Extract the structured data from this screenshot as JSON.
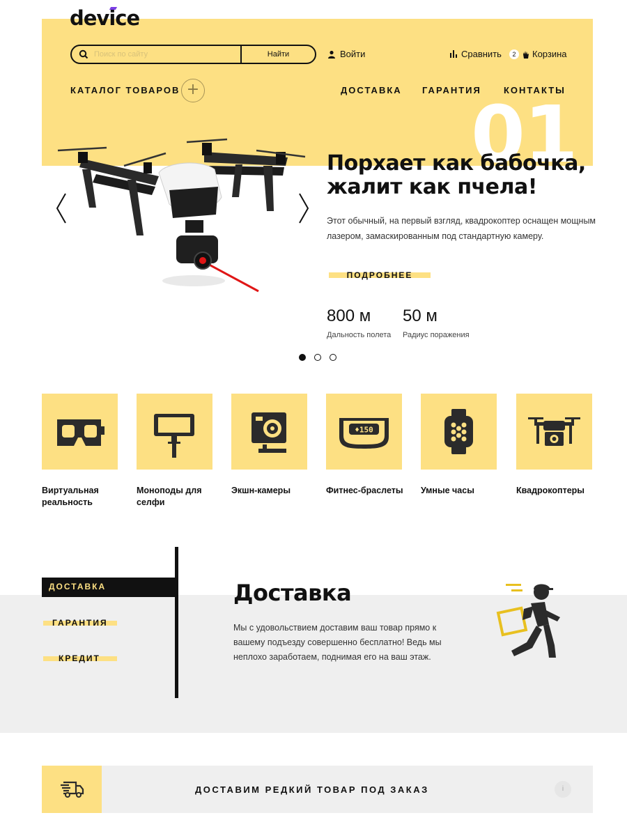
{
  "header": {
    "logo": "device",
    "search": {
      "placeholder": "Поиск по сайту",
      "button": "Найти"
    },
    "login": "Войти",
    "compare": "Сравнить",
    "cart": {
      "label": "Корзина",
      "count": "2"
    },
    "catalog": "КАТАЛОГ ТОВАРОВ",
    "nav": [
      "ДОСТАВКА",
      "ГАРАНТИЯ",
      "КОНТАКТЫ"
    ]
  },
  "slider": {
    "number": "01",
    "title": "Порхает как бабочка, жалит как пчела!",
    "text": "Этот обычный, на первый взгляд, квадрокоптер оснащен мощным лазером, замаскированным под стандартную камеру.",
    "more": "ПОДРОБНЕЕ",
    "stats": [
      {
        "value": "800 м",
        "label": "Дальность полета"
      },
      {
        "value": "50 м",
        "label": "Радиус поражения"
      }
    ],
    "active_dot": 1,
    "dots": 3
  },
  "categories": [
    {
      "label": "Виртуальная реальность",
      "icon": "vr-headset-icon"
    },
    {
      "label": "Моноподы для селфи",
      "icon": "selfie-stick-icon"
    },
    {
      "label": "Экшн-камеры",
      "icon": "action-camera-icon"
    },
    {
      "label": "Фитнес-браслеты",
      "icon": "fitness-band-icon"
    },
    {
      "label": "Умные часы",
      "icon": "smartwatch-icon"
    },
    {
      "label": "Квадрокоптеры",
      "icon": "quadcopter-icon"
    }
  ],
  "services": {
    "tabs": [
      "ДОСТАВКА",
      "ГАРАНТИЯ",
      "КРЕДИТ"
    ],
    "active_tab": "ДОСТАВКА",
    "title": "Доставка",
    "text": "Мы с удовольствием доставим ваш товар прямо к вашему подъезду совершенно бесплатно! Ведь мы неплохо заработаем, поднимая его на ваш этаж."
  },
  "rare_order": {
    "text": "ДОСТАВИМ РЕДКИЙ ТОВАР ПОД ЗАКАЗ",
    "info": "i"
  },
  "colors": {
    "accent": "#fde083",
    "dark": "#111111",
    "panel": "#efefef"
  }
}
